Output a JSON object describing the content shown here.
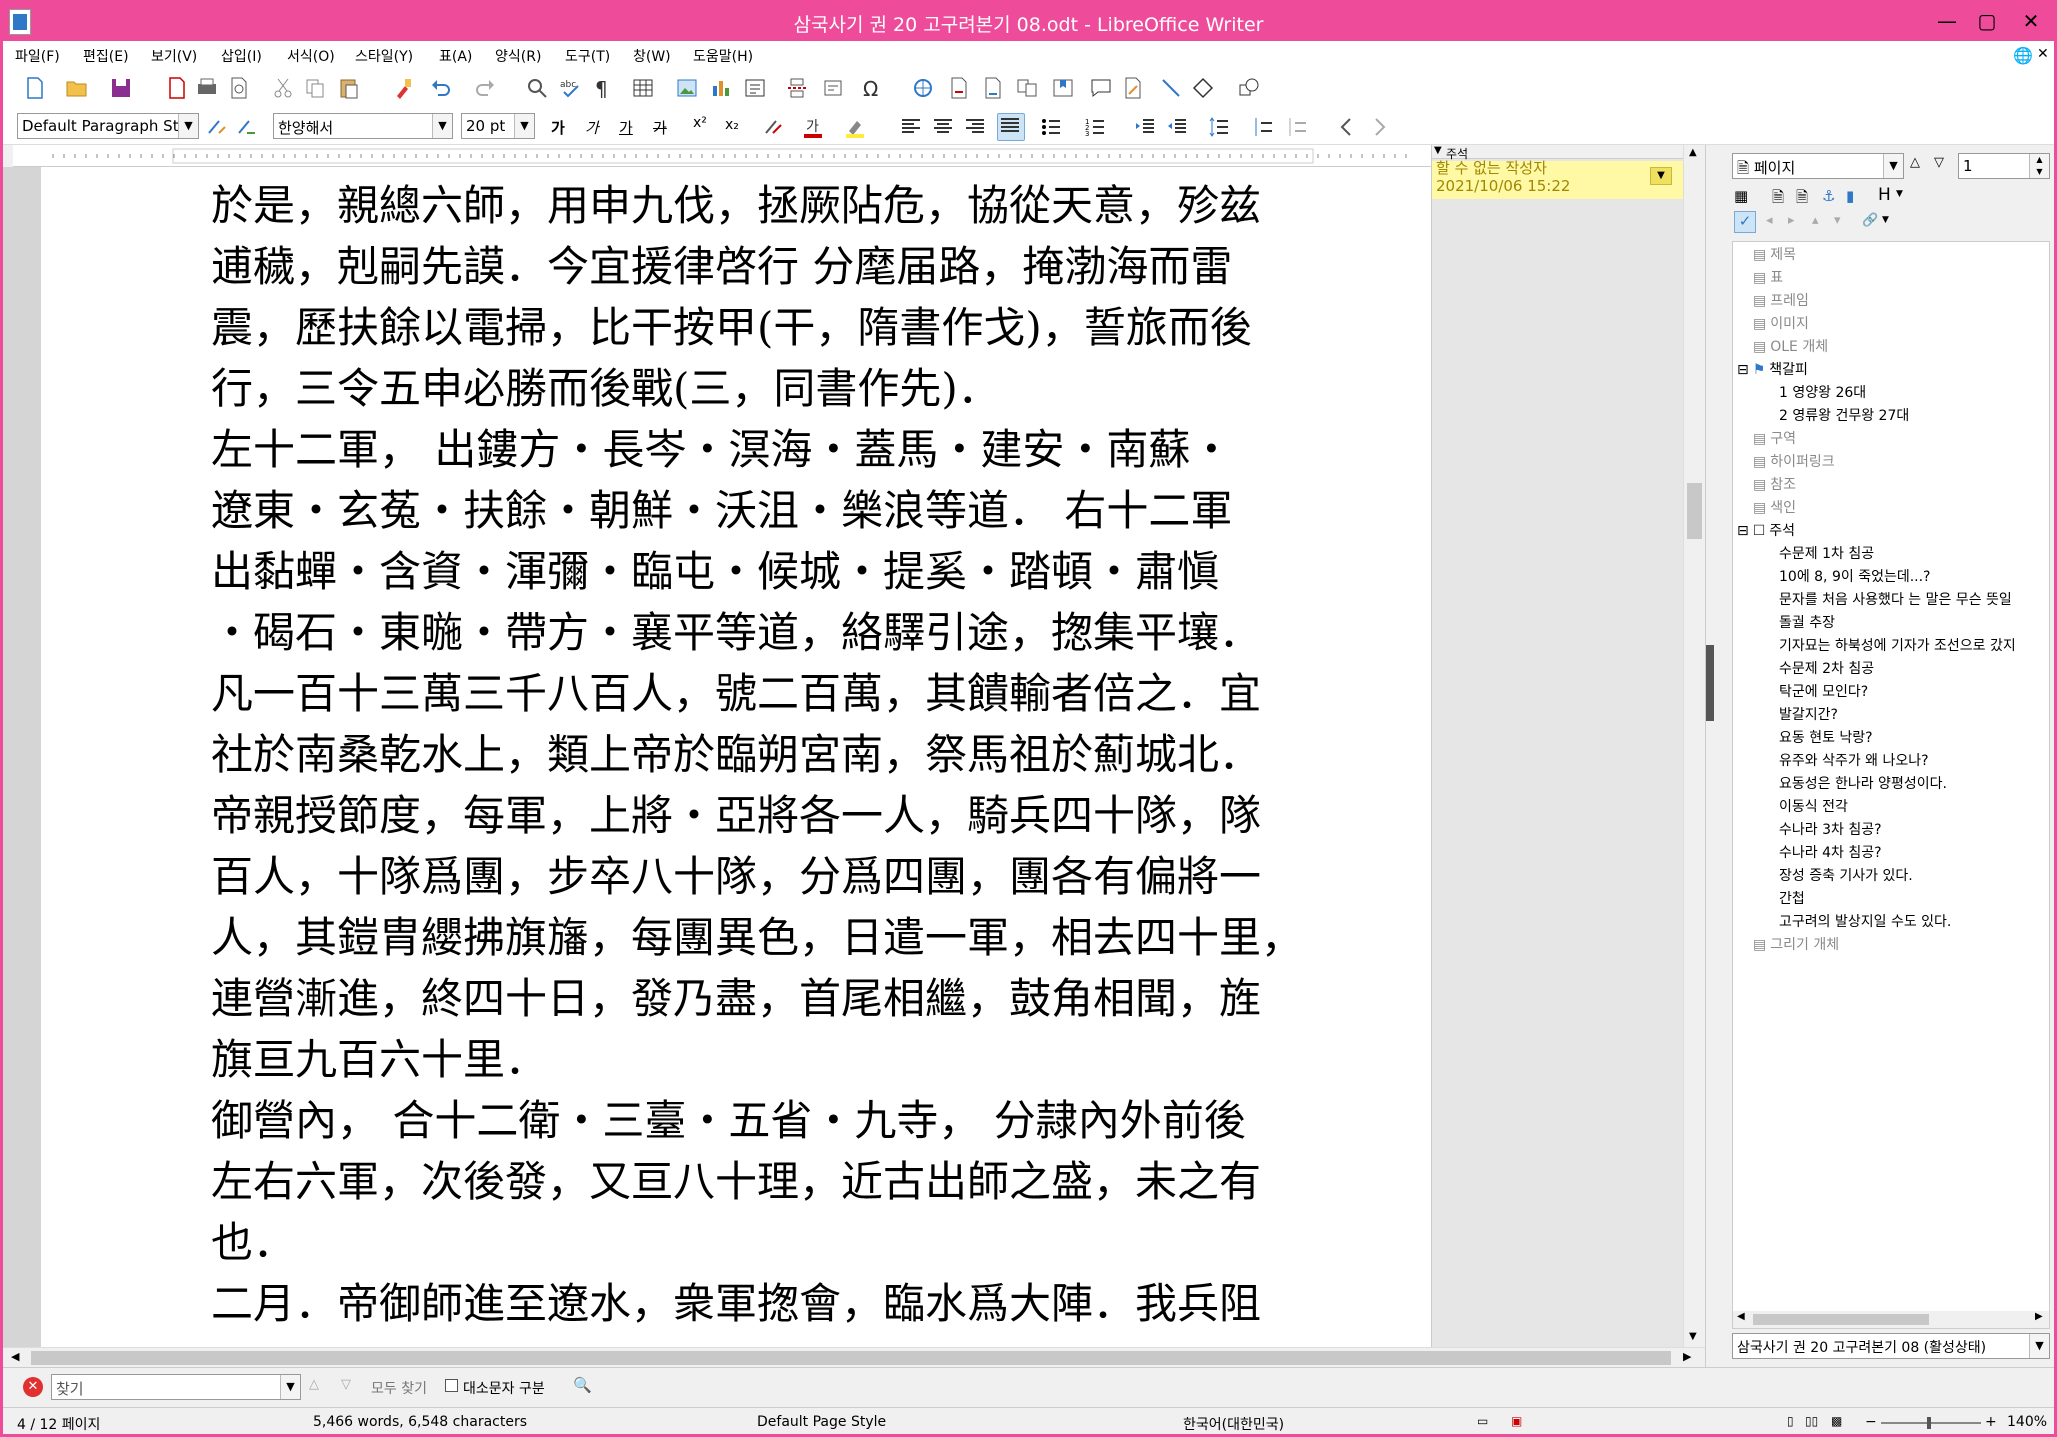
{
  "window": {
    "title": "삼국사기 권 20 고구려본기 08.odt - LibreOffice Writer"
  },
  "menu": [
    "파일(F)",
    "편집(E)",
    "보기(V)",
    "삽입(I)",
    "서식(O)",
    "스타일(Y)",
    "표(A)",
    "양식(R)",
    "도구(T)",
    "창(W)",
    "도움말(H)"
  ],
  "formatting": {
    "paragraph_style": "Default Paragraph Styl",
    "font_name": "한양해서",
    "font_size": "20 pt",
    "bold": "가",
    "italic": "가",
    "underline": "가",
    "strike": "가"
  },
  "comment": {
    "snippet": "할 수 없는 작성자",
    "date": "2021/10/06 15:22",
    "column_header": "주석"
  },
  "document": {
    "lines": [
      "於是，親總六師，用申九伐，拯厥阽危，協從天意，殄兹",
      "逋穢，剋嗣先謨．今宜援律啓行 分麾届路，掩渤海而雷",
      "震，歷扶餘以電掃，比干按甲(干，隋書作戈)，誓旅而後",
      "行，三令五申必勝而後戰(三，同書作先)．",
      "左十二軍， 出鏤方・長岑・溟海・蓋馬・建安・南蘇・",
      "遼東・玄菟・扶餘・朝鮮・沃沮・樂浪等道． 右十二軍",
      "出黏蟬・含資・渾彌・臨屯・候城・提奚・踏頓・肅愼",
      "・碣石・東暆・帶方・襄平等道，絡驛引途，揔集平壤．",
      "凡一百十三萬三千八百人，號二百萬，其饋輸者倍之．宜",
      "社於南桑乾水上，類上帝於臨朔宮南，祭馬祖於薊城北．",
      "帝親授節度，每軍，上將・亞將各一人，騎兵四十隊，隊",
      "百人，十隊爲團，步卒八十隊，分爲四團，團各有偏將一",
      "人，其鎧胄纓拂旗旛，每團異色，日遣一軍，相去四十里，",
      "連營漸進，終四十日，發乃盡，首尾相繼，鼓角相聞，旌",
      "旗亘九百六十里．",
      "御營內， 合十二衛・三臺・五省・九寺， 分隷內外前後",
      "左右六軍，次後發，又亘八十理，近古出師之盛，未之有",
      "也．",
      "二月．帝御師進至遼水，衆軍揔會，臨水爲大陣．我兵阻"
    ]
  },
  "navigator": {
    "category_select": "페이지",
    "page_number": "1",
    "items": [
      {
        "label": "제목",
        "indent": 1,
        "style": "grey"
      },
      {
        "label": "표",
        "indent": 1,
        "style": "grey"
      },
      {
        "label": "프레임",
        "indent": 1,
        "style": "grey"
      },
      {
        "label": "이미지",
        "indent": 1,
        "style": "grey"
      },
      {
        "label": "OLE 개체",
        "indent": 1,
        "style": "grey"
      },
      {
        "label": "책갈피",
        "indent": 0,
        "style": "bold"
      },
      {
        "label": "1 영양왕 26대",
        "indent": 2,
        "style": "child"
      },
      {
        "label": "2 영류왕 건무왕 27대",
        "indent": 2,
        "style": "child"
      },
      {
        "label": "구역",
        "indent": 1,
        "style": "grey"
      },
      {
        "label": "하이퍼링크",
        "indent": 1,
        "style": "grey"
      },
      {
        "label": "참조",
        "indent": 1,
        "style": "grey"
      },
      {
        "label": "색인",
        "indent": 1,
        "style": "grey"
      },
      {
        "label": "주석",
        "indent": 0,
        "style": "bold"
      },
      {
        "label": "수문제 1차 침공",
        "indent": 2,
        "style": "child"
      },
      {
        "label": "10에 8, 9이 죽었는데...?",
        "indent": 2,
        "style": "child"
      },
      {
        "label": "문자를 처음 사용했다 는 말은 무슨 뜻일",
        "indent": 2,
        "style": "child"
      },
      {
        "label": "돌궐 추장",
        "indent": 2,
        "style": "child"
      },
      {
        "label": "기자묘는 하북성에 기자가 조선으로 갔지",
        "indent": 2,
        "style": "child"
      },
      {
        "label": "수문제 2차 침공",
        "indent": 2,
        "style": "child"
      },
      {
        "label": "탁군에 모인다?",
        "indent": 2,
        "style": "child"
      },
      {
        "label": "발갈지간?",
        "indent": 2,
        "style": "child"
      },
      {
        "label": "요동 현토 낙랑?",
        "indent": 2,
        "style": "child"
      },
      {
        "label": "유주와 삭주가 왜 나오나?",
        "indent": 2,
        "style": "child"
      },
      {
        "label": "요동성은 한나라 양평성이다.",
        "indent": 2,
        "style": "child"
      },
      {
        "label": "이동식 전각",
        "indent": 2,
        "style": "child"
      },
      {
        "label": "수나라 3차 침공?",
        "indent": 2,
        "style": "child"
      },
      {
        "label": "수나라 4차 침공?",
        "indent": 2,
        "style": "child"
      },
      {
        "label": "장성 증축 기사가 있다.",
        "indent": 2,
        "style": "child"
      },
      {
        "label": "간첩",
        "indent": 2,
        "style": "child"
      },
      {
        "label": "고구려의 발상지일 수도 있다.",
        "indent": 2,
        "style": "child"
      },
      {
        "label": "그리기 개체",
        "indent": 1,
        "style": "grey"
      }
    ],
    "document_select": "삼국사기 권 20 고구려본기 08 (활성상태)"
  },
  "find": {
    "placeholder": "찾기",
    "find_all": "모두 찾기",
    "match_case": "대소문자 구분"
  },
  "status": {
    "page": "4 / 12 페이지",
    "words": "5,466 words, 6,548 characters",
    "page_style": "Default Page Style",
    "language": "한국어(대한민국)",
    "zoom": "140%"
  },
  "colors": {
    "titlebar": "#ee4c9b",
    "comment": "#fff9a6"
  }
}
